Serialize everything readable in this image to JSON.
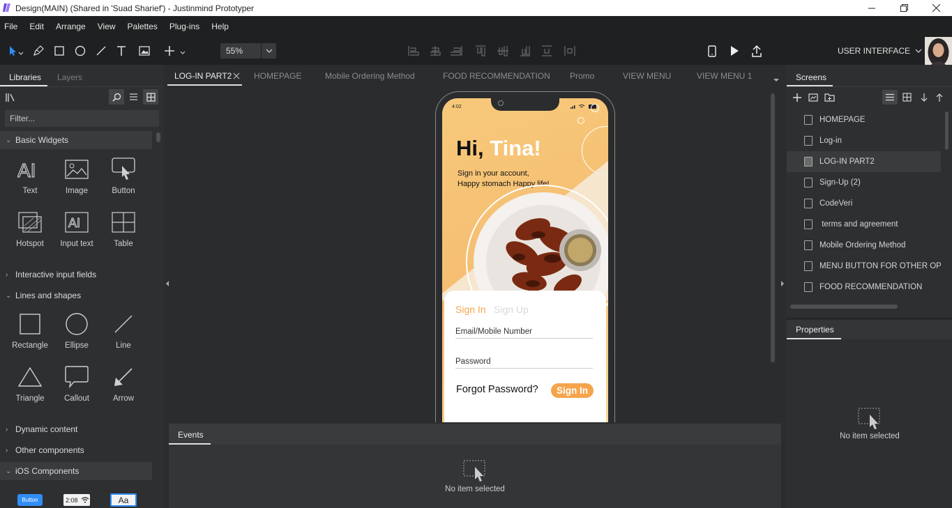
{
  "window": {
    "title": "Design(MAIN) (Shared in 'Suad Sharief') - Justinmind Prototyper"
  },
  "menu": [
    "File",
    "Edit",
    "Arrange",
    "View",
    "Palettes",
    "Plug-ins",
    "Help"
  ],
  "toolbar": {
    "zoom": "55%",
    "ui_mode": "USER INTERFACE"
  },
  "left_panel": {
    "tabs": [
      "Libraries",
      "Layers"
    ],
    "filter_placeholder": "Filter...",
    "sections": {
      "basic": "Basic Widgets",
      "interactive": "Interactive input fields",
      "lines": "Lines and shapes",
      "dynamic": "Dynamic content",
      "other": "Other components",
      "ios": "iOS Components"
    },
    "basic_widgets": [
      "Text",
      "Image",
      "Button",
      "Hotspot",
      "Input text",
      "Table"
    ],
    "shapes": [
      "Rectangle",
      "Ellipse",
      "Line",
      "Triangle",
      "Callout",
      "Arrow"
    ],
    "ios_items": {
      "button": "Button",
      "status": "2:08",
      "text": "Aa"
    }
  },
  "canvas_tabs": [
    "LOG-IN PART2",
    "HOMEPAGE",
    "Mobile Ordering Method",
    "FOOD RECOMMENDATION",
    "Promo",
    "VIEW MENU",
    "VIEW MENU 1"
  ],
  "phone": {
    "time": "4:02",
    "greeting_hi": "Hi, ",
    "greeting_name": "Tina!",
    "subtitle1": "Sign in your account,",
    "subtitle2": "Happy stomach Happy life!",
    "tab_signin": "Sign In",
    "tab_signup": "Sign Up",
    "email_label": "Email/Mobile Number",
    "password_label": "Password",
    "forgot": "Forgot Password?",
    "signin_btn": "Sign In"
  },
  "events": {
    "tab": "Events",
    "empty": "No item selected"
  },
  "right_panel": {
    "screens_title": "Screens",
    "screens": [
      "HOMEPAGE",
      "Log-in",
      "LOG-IN PART2",
      "Sign-Up (2)",
      "CodeVeri",
      " terms and agreement",
      "Mobile Ordering Method",
      "MENU BUTTON FOR OTHER OPTI",
      "FOOD RECOMMENDATION"
    ],
    "properties_title": "Properties",
    "properties_empty": "No item selected"
  },
  "colors": {
    "accent": "#f5a44b",
    "panel": "#2e2f31",
    "toolbar": "#1f2021"
  }
}
